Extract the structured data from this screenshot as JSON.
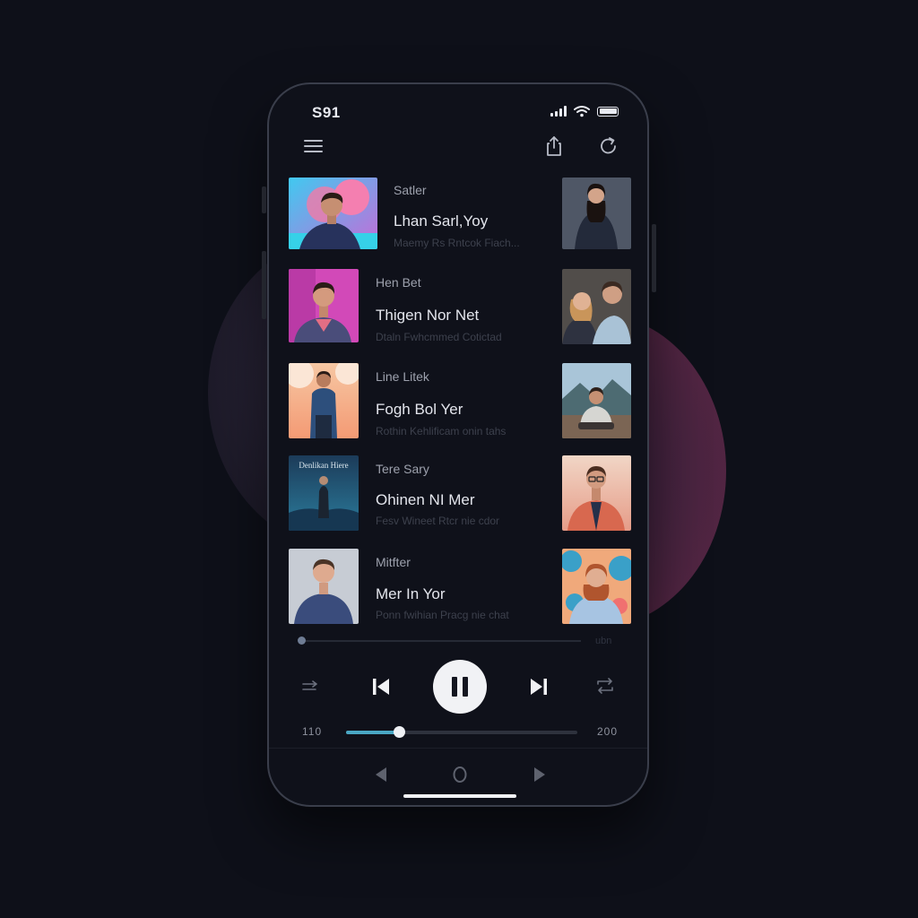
{
  "status": {
    "time": "S91",
    "icons": [
      "signal-icon",
      "wifi-icon",
      "battery-icon"
    ]
  },
  "topbar": {
    "icons": [
      "menu-icon",
      "share-icon",
      "refresh-icon"
    ]
  },
  "tracks": [
    {
      "title": "Satler",
      "name": "Lhan Sarl,Yoy",
      "subtitle": "Maemy Rs Rntcok Fiach..."
    },
    {
      "title": "Hen Bet",
      "name": "Thigen Nor Net",
      "subtitle": "Dtaln Fwhcmmed Cotictad"
    },
    {
      "title": "Line Litek",
      "name": "Fogh Bol Yer",
      "subtitle": "Rothin Kehlificam onin tahs"
    },
    {
      "title": "Tere Sary",
      "name": "Ohinen NI Mer",
      "subtitle": "Fesv Wineet Rtcr nie cdor"
    },
    {
      "title": "Mitfter",
      "name": "Mer In Yor",
      "subtitle": "Ponn fwihian Pracg nie chat"
    }
  ],
  "album_art_text": "Denlikan Hiere",
  "player": {
    "top_progress_time": "ubn",
    "elapsed": "110",
    "duration": "200",
    "seek_progress": 0.23,
    "state": "playing"
  },
  "controls": [
    "shuffle-icon",
    "previous-icon",
    "pause-icon",
    "next-icon",
    "repeat-icon"
  ],
  "colors": {
    "background": "#0e1019",
    "phone": "#0f111a",
    "accent": "#4aa7c4",
    "text": "#e3e5ec"
  }
}
